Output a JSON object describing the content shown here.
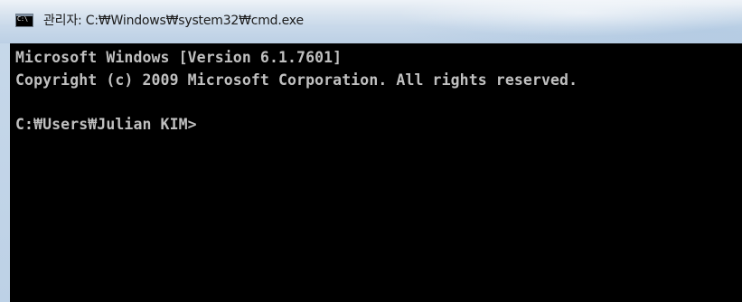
{
  "window": {
    "title": "관리자: C:₩Windows₩system32₩cmd.exe",
    "icon": "cmd-icon",
    "icon_text": "C:\\"
  },
  "console": {
    "lines": [
      "Microsoft Windows [Version 6.1.7601]",
      "Copyright (c) 2009 Microsoft Corporation. All rights reserved.",
      "",
      "C:₩Users₩Julian KIM>"
    ]
  },
  "colors": {
    "console_background": "#000000",
    "console_text": "#c0c0c0",
    "titlebar": "#c9d9ea"
  }
}
